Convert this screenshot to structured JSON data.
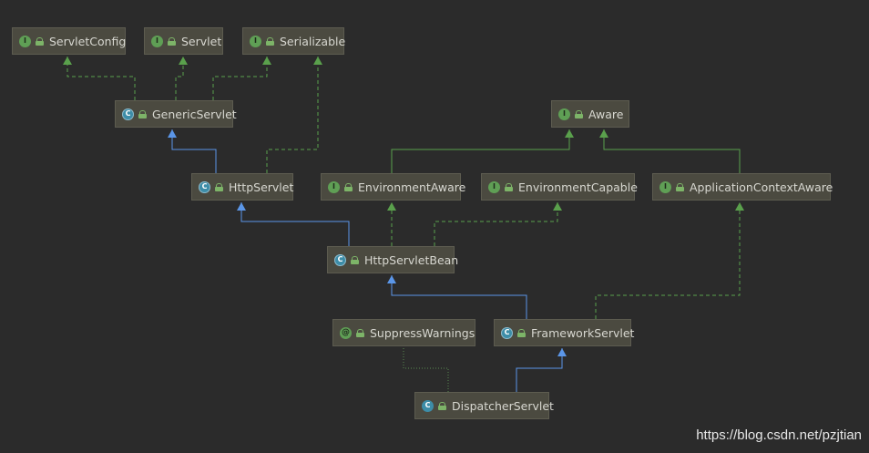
{
  "colors": {
    "background": "#2b2b2b",
    "node_fill": "#4b4a40",
    "extends_line": "#5b96e8",
    "implements_line": "#5aa04c",
    "annotation_line": "#5a8a50"
  },
  "nodes": [
    {
      "id": "servletconfig",
      "label": "ServletConfig",
      "kind": "interface",
      "icon": "interface-icon"
    },
    {
      "id": "servlet",
      "label": "Servlet",
      "kind": "interface",
      "icon": "interface-icon"
    },
    {
      "id": "serializable",
      "label": "Serializable",
      "kind": "interface",
      "icon": "interface-icon"
    },
    {
      "id": "genericservlet",
      "label": "GenericServlet",
      "kind": "abstract-class",
      "icon": "abstract-class-icon"
    },
    {
      "id": "aware",
      "label": "Aware",
      "kind": "interface",
      "icon": "interface-icon"
    },
    {
      "id": "httpservlet",
      "label": "HttpServlet",
      "kind": "abstract-class",
      "icon": "abstract-class-icon"
    },
    {
      "id": "environmentaware",
      "label": "EnvironmentAware",
      "kind": "interface",
      "icon": "interface-icon"
    },
    {
      "id": "environmentcapable",
      "label": "EnvironmentCapable",
      "kind": "interface",
      "icon": "interface-icon"
    },
    {
      "id": "applicationcontextaware",
      "label": "ApplicationContextAware",
      "kind": "interface",
      "icon": "interface-icon"
    },
    {
      "id": "httpservletbean",
      "label": "HttpServletBean",
      "kind": "abstract-class",
      "icon": "abstract-class-icon"
    },
    {
      "id": "suppresswarnings",
      "label": "SuppressWarnings",
      "kind": "annotation",
      "icon": "annotation-icon"
    },
    {
      "id": "frameworkservlet",
      "label": "FrameworkServlet",
      "kind": "abstract-class",
      "icon": "abstract-class-icon"
    },
    {
      "id": "dispatcherservlet",
      "label": "DispatcherServlet",
      "kind": "class",
      "icon": "class-icon"
    }
  ],
  "edges": [
    {
      "from": "genericservlet",
      "to": "servletconfig",
      "type": "implements"
    },
    {
      "from": "genericservlet",
      "to": "servlet",
      "type": "implements"
    },
    {
      "from": "genericservlet",
      "to": "serializable",
      "type": "implements"
    },
    {
      "from": "httpservlet",
      "to": "genericservlet",
      "type": "extends"
    },
    {
      "from": "httpservlet",
      "to": "serializable",
      "type": "implements"
    },
    {
      "from": "environmentaware",
      "to": "aware",
      "type": "extends-interface"
    },
    {
      "from": "applicationcontextaware",
      "to": "aware",
      "type": "extends-interface"
    },
    {
      "from": "httpservletbean",
      "to": "httpservlet",
      "type": "extends"
    },
    {
      "from": "httpservletbean",
      "to": "environmentaware",
      "type": "implements"
    },
    {
      "from": "httpservletbean",
      "to": "environmentcapable",
      "type": "implements"
    },
    {
      "from": "frameworkservlet",
      "to": "httpservletbean",
      "type": "extends"
    },
    {
      "from": "frameworkservlet",
      "to": "applicationcontextaware",
      "type": "implements"
    },
    {
      "from": "dispatcherservlet",
      "to": "frameworkservlet",
      "type": "extends"
    },
    {
      "from": "dispatcherservlet",
      "to": "suppresswarnings",
      "type": "annotated"
    }
  ],
  "watermark": "https://blog.csdn.net/pzjtian"
}
